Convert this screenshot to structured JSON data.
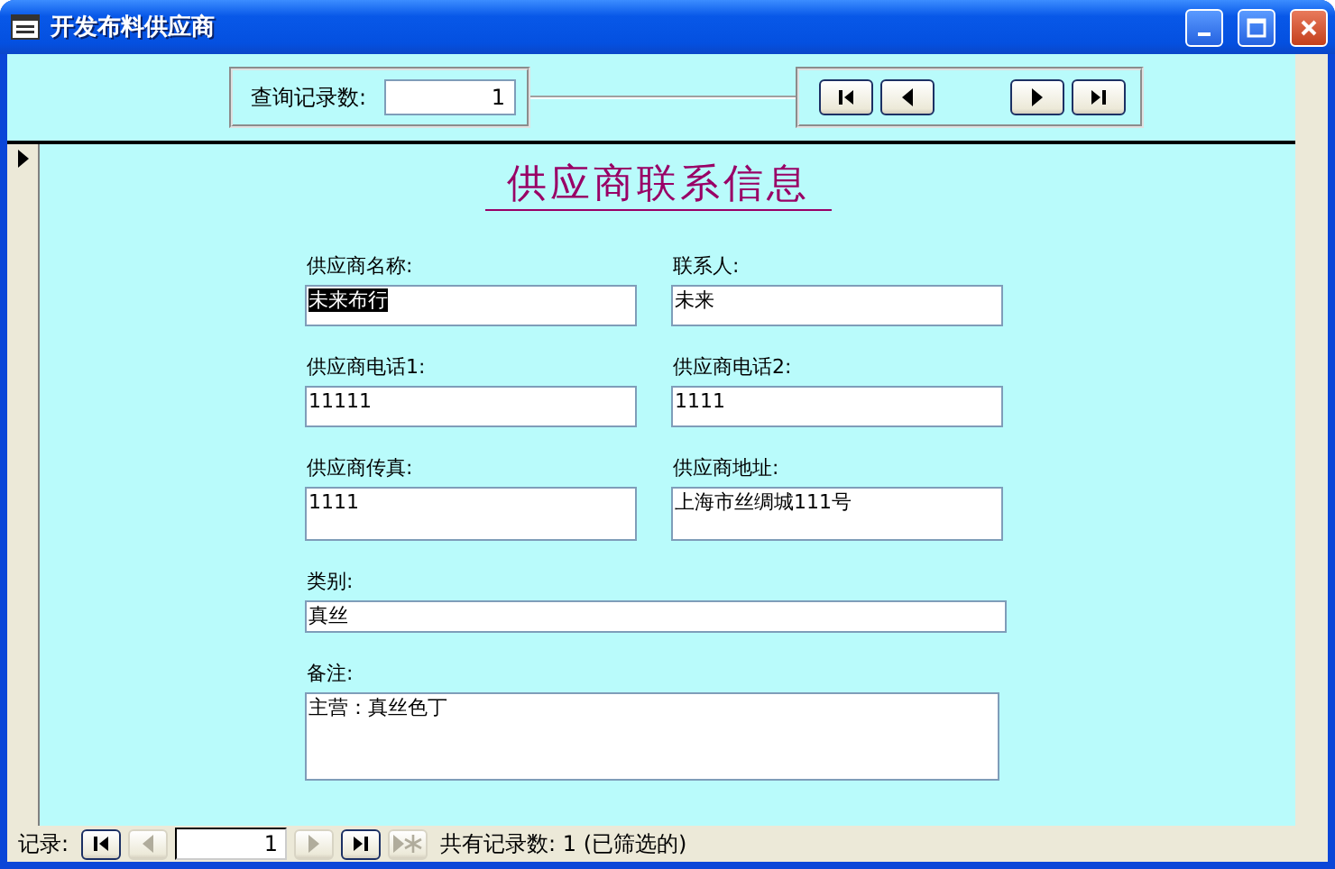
{
  "window": {
    "title": "开发布料供应商"
  },
  "header": {
    "query_label": "查询记录数:",
    "query_value": "1",
    "nav_buttons": [
      {
        "kind": "first",
        "disabled": false
      },
      {
        "kind": "prev",
        "disabled": false
      },
      {
        "kind": "next",
        "disabled": false
      },
      {
        "kind": "last",
        "disabled": false
      }
    ]
  },
  "form": {
    "title": "供应商联系信息",
    "fields": [
      {
        "label": "供应商名称:",
        "value": "未来布行",
        "kind": "text",
        "selected": true
      },
      {
        "label": "联系人:",
        "value": "未来",
        "kind": "text",
        "selected": false
      },
      {
        "label": "供应商电话1:",
        "value": "11111",
        "kind": "text",
        "selected": false
      },
      {
        "label": "供应商电话2:",
        "value": "1111",
        "kind": "text",
        "selected": false
      },
      {
        "label": "供应商传真:",
        "value": "1111",
        "kind": "multiline",
        "selected": false
      },
      {
        "label": "供应商地址:",
        "value": "上海市丝绸城111号",
        "kind": "multiline",
        "selected": false
      },
      {
        "label": "类别:",
        "value": "真丝",
        "kind": "wide",
        "selected": false
      },
      {
        "label": "备注:",
        "value": "主营：真丝色丁",
        "kind": "memo",
        "selected": false
      }
    ]
  },
  "status_bar": {
    "label": "记录:",
    "record": "1",
    "nav_buttons": [
      {
        "kind": "first",
        "disabled": false
      },
      {
        "kind": "prev",
        "disabled": true
      },
      {
        "kind": "record"
      },
      {
        "kind": "next",
        "disabled": true
      },
      {
        "kind": "last",
        "disabled": false
      },
      {
        "kind": "new",
        "disabled": true
      }
    ],
    "summary": "共有记录数: 1 (已筛选的)"
  }
}
